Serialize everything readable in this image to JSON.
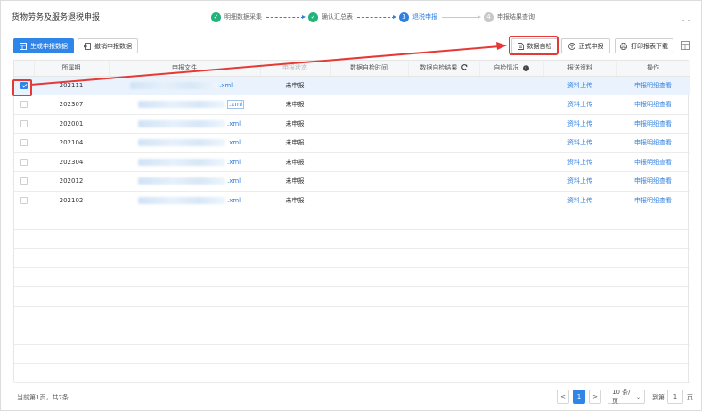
{
  "header": {
    "title": "货物劳务及服务退税申报",
    "steps": [
      {
        "num": "",
        "label": "明细数据采集",
        "state": "done"
      },
      {
        "num": "",
        "label": "确认汇总表",
        "state": "done"
      },
      {
        "num": "3",
        "label": "退税申报",
        "state": "active"
      },
      {
        "num": "4",
        "label": "申报结果查询",
        "state": "todo"
      }
    ]
  },
  "toolbar": {
    "generate_label": "生成申报数据",
    "revoke_label": "撤销申报数据",
    "selfcheck_label": "数据自检",
    "submit_label": "正式申报",
    "print_label": "打印报表下载"
  },
  "table": {
    "columns": [
      "所属期",
      "申报文件",
      "申报状态",
      "数据自检时间",
      "数据自检结果",
      "自检情况",
      "报送资料",
      "操作"
    ],
    "rows": [
      {
        "checked": true,
        "period": "202111",
        "file_ext": ".xml",
        "status": "未申报",
        "upload": "资料上传",
        "action": "申报明细查看"
      },
      {
        "checked": false,
        "period": "202307",
        "file_ext": ".xml",
        "status": "未申报",
        "upload": "资料上传",
        "action": "申报明细查看"
      },
      {
        "checked": false,
        "period": "202001",
        "file_ext": ".xml",
        "status": "未申报",
        "upload": "资料上传",
        "action": "申报明细查看"
      },
      {
        "checked": false,
        "period": "202104",
        "file_ext": ".xml",
        "status": "未申报",
        "upload": "资料上传",
        "action": "申报明细查看"
      },
      {
        "checked": false,
        "period": "202304",
        "file_ext": ".xml",
        "status": "未申报",
        "upload": "资料上传",
        "action": "申报明细查看"
      },
      {
        "checked": false,
        "period": "202012",
        "file_ext": ".xml",
        "status": "未申报",
        "upload": "资料上传",
        "action": "申报明细查看"
      },
      {
        "checked": false,
        "period": "202102",
        "file_ext": ".xml",
        "status": "未申报",
        "upload": "资料上传",
        "action": "申报明细查看"
      }
    ]
  },
  "footer": {
    "info": "当前第1页，共7条",
    "page_prev": "<",
    "page_current": "1",
    "page_next": ">",
    "page_size": "10 条/页",
    "goto_label": "到第",
    "goto_value": "1",
    "page_suffix": "页"
  },
  "colors": {
    "primary": "#2f86e8",
    "done": "#22b37a",
    "highlight": "#e53935"
  }
}
